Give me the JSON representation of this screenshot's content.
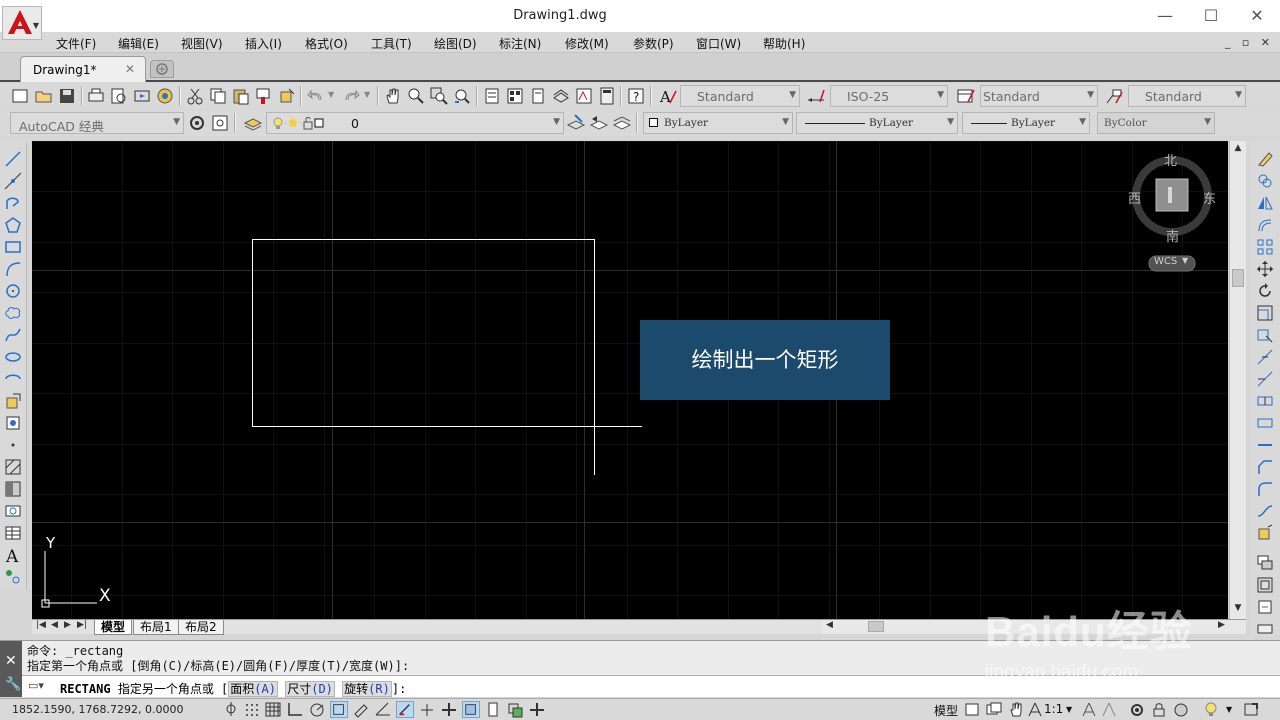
{
  "window": {
    "title": "Drawing1.dwg",
    "minimize": "—",
    "maximize": "☐",
    "close": "✕"
  },
  "menu": [
    "文件(F)",
    "编辑(E)",
    "视图(V)",
    "插入(I)",
    "格式(O)",
    "工具(T)",
    "绘图(D)",
    "标注(N)",
    "修改(M)",
    "参数(P)",
    "窗口(W)",
    "帮助(H)"
  ],
  "tabs": {
    "doc": "Drawing1*",
    "close": "✕"
  },
  "styles": {
    "text_style": "Standard",
    "dim_style": "ISO-25",
    "table_style": "Standard",
    "mleader_style": "Standard"
  },
  "workspace": "AutoCAD 经典",
  "layer": "0",
  "properties": {
    "color": "ByLayer",
    "linetype": "ByLayer",
    "lineweight": "ByLayer",
    "plotstyle": "ByColor"
  },
  "viewcube": {
    "north": "北",
    "south": "南",
    "east": "东",
    "west": "西",
    "coords": "WCS"
  },
  "ucs": {
    "x": "X",
    "y": "Y"
  },
  "caption": "绘制出一个矩形",
  "layout_tabs": [
    "模型",
    "布局1",
    "布局2"
  ],
  "command": {
    "line1": "命令: _rectang",
    "line2": "指定第一个角点或 [倒角(C)/标高(E)/圆角(F)/厚度(T)/宽度(W)]:",
    "keyword": "RECTANG",
    "prompt": "指定另一个角点或 [",
    "opt1": "面积",
    "opt1_key": "(A)",
    "opt2": "尺寸",
    "opt2_key": "(D)",
    "opt3": "旋转",
    "opt3_key": "(R)",
    "end": "]:"
  },
  "status": {
    "coords": "1852.1590, 1768.7292, 0.0000",
    "model": "模型",
    "scale": "1:1"
  },
  "watermark": {
    "logo": "Baidu经验",
    "url": "jingyan.baidu.com"
  },
  "colors": {
    "canvas": "#000000",
    "caption_bg": "#1b4a6c",
    "grid": "#1f1f1f",
    "app_red": "#c8151b"
  }
}
